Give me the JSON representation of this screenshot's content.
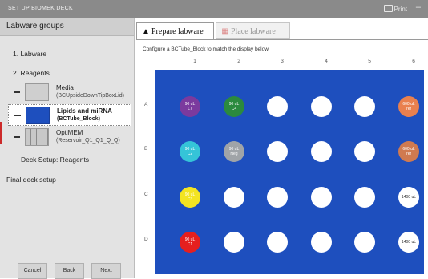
{
  "window": {
    "title": "SET UP BIOMEK DECK",
    "print_label": "Print",
    "minimize_label": "–"
  },
  "left_panel": {
    "header": "Labware groups",
    "step1": "1. Labware",
    "step2": "2. Reagents",
    "reagents": [
      {
        "name": "Media",
        "sub": "(BCUpsideDownTipBoxLid)"
      },
      {
        "name": "Lipids and miRNA",
        "sub": "(BCTube_Block)"
      },
      {
        "name": "OptiMEM",
        "sub": "(Reservoir_Q1_Q1_Q_Q)"
      }
    ],
    "deck_setup": "Deck Setup: Reagents",
    "final": "Final deck setup",
    "buttons": {
      "cancel": "Cancel",
      "back": "Back",
      "next": "Next"
    }
  },
  "tabs": {
    "prepare": "Prepare labware",
    "place": "Place labware"
  },
  "instruction": "Configure a BCTube_Block to match the display below.",
  "plate": {
    "columns": [
      "1",
      "2",
      "3",
      "4",
      "5",
      "6"
    ],
    "rows": [
      "A",
      "B",
      "C",
      "D"
    ],
    "wells": [
      [
        {
          "l1": "90 uL",
          "l2": "L7",
          "color": "#7b3a9e"
        },
        {
          "l1": "90 uL",
          "l2": "C4",
          "color": "#2b8a3e"
        },
        {
          "l1": "",
          "l2": "",
          "color": "#ffffff"
        },
        {
          "l1": "",
          "l2": "",
          "color": "#ffffff"
        },
        {
          "l1": "",
          "l2": "",
          "color": "#ffffff"
        },
        {
          "l1": "600 uL",
          "l2": "ref",
          "color": "#e9804e"
        }
      ],
      [
        {
          "l1": "90 uL",
          "l2": "C2",
          "color": "#35c4d8"
        },
        {
          "l1": "90 uL",
          "l2": "Neg",
          "color": "#a0a4a8"
        },
        {
          "l1": "",
          "l2": "",
          "color": "#ffffff"
        },
        {
          "l1": "",
          "l2": "",
          "color": "#ffffff"
        },
        {
          "l1": "",
          "l2": "",
          "color": "#ffffff"
        },
        {
          "l1": "600 uL",
          "l2": "ref",
          "color": "#d07a50"
        }
      ],
      [
        {
          "l1": "90 uL",
          "l2": "C3",
          "color": "#f3e422"
        },
        {
          "l1": "",
          "l2": "",
          "color": "#ffffff"
        },
        {
          "l1": "",
          "l2": "",
          "color": "#ffffff"
        },
        {
          "l1": "",
          "l2": "",
          "color": "#ffffff"
        },
        {
          "l1": "",
          "l2": "",
          "color": "#ffffff"
        },
        {
          "l1": "1400 uL",
          "l2": "",
          "color": "#ffffff"
        }
      ],
      [
        {
          "l1": "90 uL",
          "l2": "C1",
          "color": "#e51f1f"
        },
        {
          "l1": "",
          "l2": "",
          "color": "#ffffff"
        },
        {
          "l1": "",
          "l2": "",
          "color": "#ffffff"
        },
        {
          "l1": "",
          "l2": "",
          "color": "#ffffff"
        },
        {
          "l1": "",
          "l2": "",
          "color": "#ffffff"
        },
        {
          "l1": "1400 uL",
          "l2": "",
          "color": "#ffffff"
        }
      ]
    ]
  },
  "colors": {
    "plate_blue": "#1e4fbe",
    "selection_red": "#cc2a2a",
    "header_gray": "#8a8a8a"
  }
}
